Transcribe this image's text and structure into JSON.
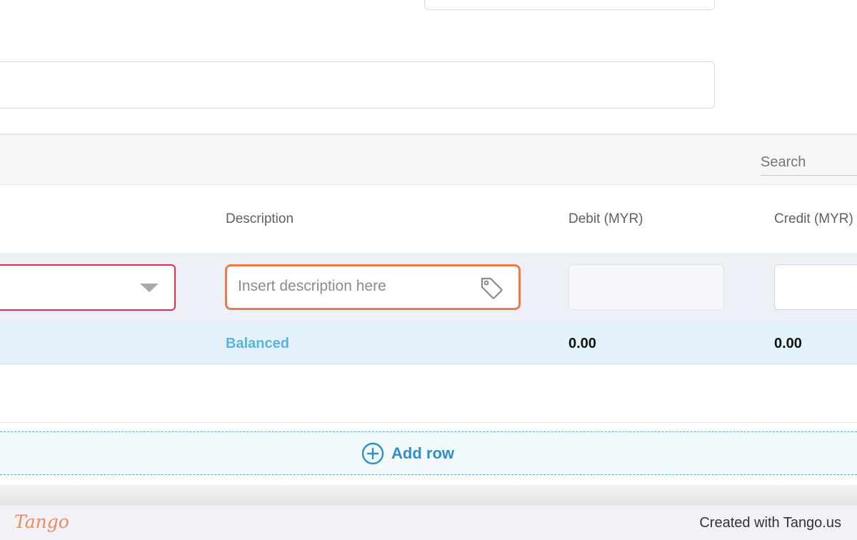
{
  "toolbar": {
    "search_placeholder": "Search"
  },
  "table": {
    "columns": {
      "description": "Description",
      "debit": "Debit (MYR)",
      "credit": "Credit (MYR)"
    },
    "row": {
      "description_placeholder": "Insert description here"
    },
    "totals": {
      "status": "Balanced",
      "debit": "0.00",
      "credit": "0.00"
    }
  },
  "actions": {
    "add_row_label": "Add row"
  },
  "footer": {
    "brand": "Tango",
    "credit": "Created with Tango.us"
  },
  "colors": {
    "focus_outline": "#f07a46",
    "error_border": "#d9304f",
    "link_blue": "#2d8fcb",
    "balanced": "#5ab3df"
  },
  "icons": {
    "tag": "tag-icon",
    "caret": "caret-down-icon",
    "add": "plus-circle-icon"
  }
}
